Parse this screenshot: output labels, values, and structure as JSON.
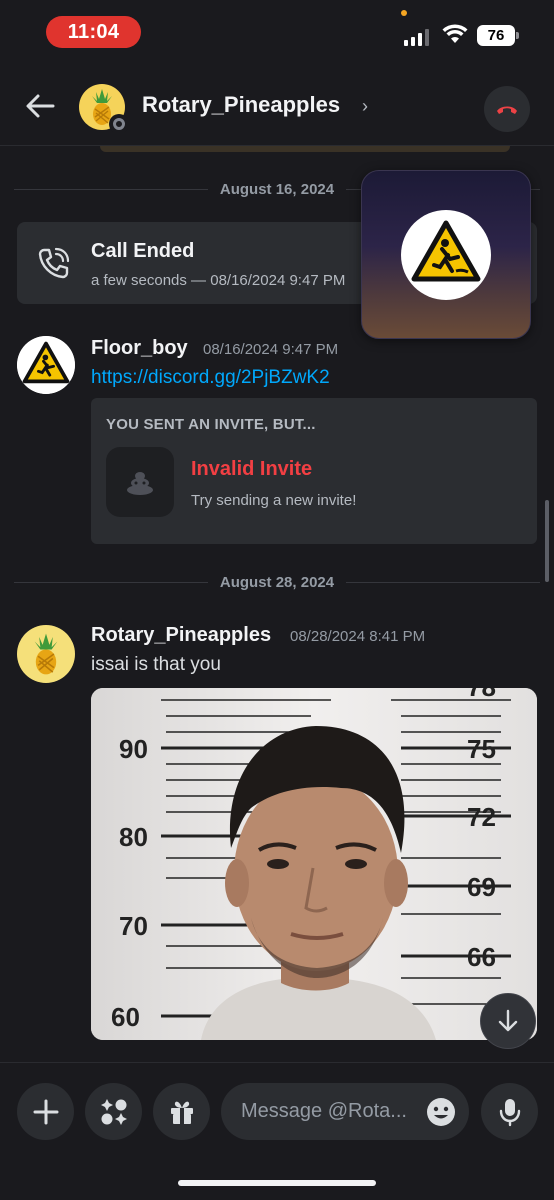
{
  "status_bar": {
    "time": "11:04",
    "battery": "76"
  },
  "header": {
    "channel_name": "Rotary_Pineapples",
    "chevron": "›"
  },
  "dividers": [
    "August 16, 2024",
    "August 28, 2024"
  ],
  "call_card": {
    "title": "Call Ended",
    "subtitle": "a few seconds — 08/16/2024 9:47 PM"
  },
  "messages": [
    {
      "author": "Floor_boy",
      "timestamp": "08/16/2024 9:47 PM",
      "link": "https://discord.gg/2PjBZwK2",
      "invite": {
        "heading": "YOU SENT AN INVITE, BUT...",
        "title": "Invalid Invite",
        "subtitle": "Try sending a new invite!"
      }
    },
    {
      "author": "Rotary_Pineapples",
      "timestamp": "08/28/2024 8:41 PM",
      "text": "issai is that you",
      "attachment_scale_labels": {
        "left": [
          "90",
          "80",
          "70",
          "60"
        ],
        "right": [
          "78",
          "75",
          "72",
          "69",
          "66"
        ]
      }
    }
  ],
  "composer": {
    "placeholder": "Message @Rota..."
  },
  "colors": {
    "background": "#1a1a1e",
    "card": "#2b2d31",
    "link": "#00a8fc",
    "danger": "#f23f43",
    "time_pill": "#e0342e"
  },
  "icons": [
    "back-arrow-icon",
    "hangup-icon",
    "phone-call-icon",
    "plus-icon",
    "apps-icon",
    "gift-icon",
    "emoji-icon",
    "microphone-icon",
    "arrow-down-icon"
  ]
}
